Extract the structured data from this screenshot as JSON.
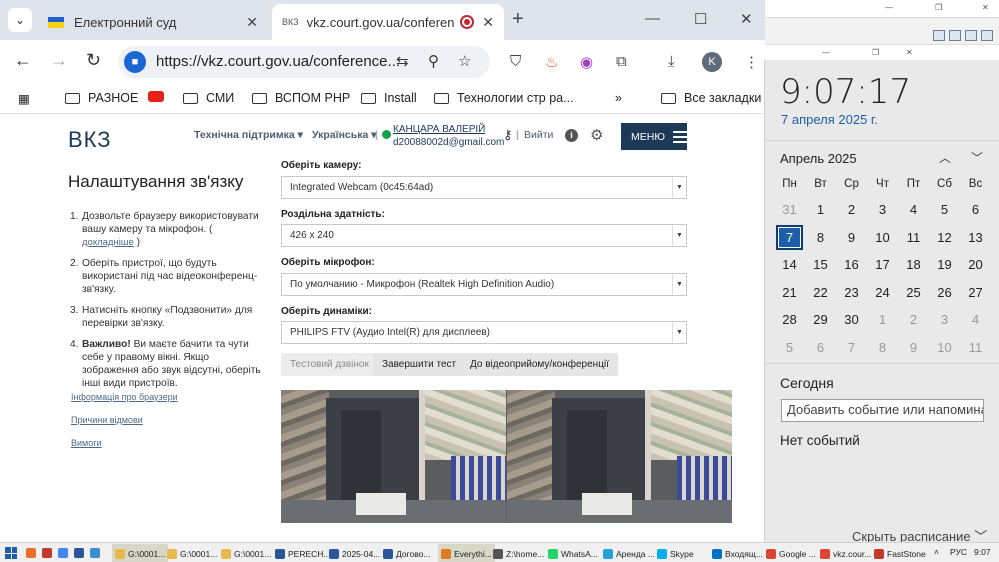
{
  "browser": {
    "tabs": [
      {
        "title": "Електронний суд",
        "favicon": "ukraine-flag-icon",
        "active": false
      },
      {
        "title": "vkz.court.gov.ua/conferenc",
        "favicon_text": "ВКЗ",
        "active": true
      }
    ],
    "url": "https://vkz.court.gov.ua/conference...",
    "profile_initial": "K",
    "bookmarks": [
      "РАЗНОЕ",
      "СМИ",
      "ВСПОМ PHP",
      "Install",
      "Технологии стр ра...",
      "Все закладки"
    ]
  },
  "site": {
    "logo": "ВКЗ",
    "nav": {
      "support": "Технічна підтримка",
      "language": "Українська",
      "user_name": "КАНЦАРА ВАЛЕРІЙ",
      "user_email": "d20088002d@gmail.com",
      "logout": "Вийти",
      "menu": "МЕНЮ"
    },
    "title": "Налаштування зв'язку",
    "steps": [
      {
        "num": "1.",
        "text": "Дозвольте браузеру використовувати вашу камеру та мікрофон. (",
        "link": "докладніше",
        "after": ")"
      },
      {
        "num": "2.",
        "text": "Оберіть пристрої, що будуть використані під час відеоконференц-зв'язку."
      },
      {
        "num": "3.",
        "text": "Натисніть кнопку «Подзвонити» для перевірки зв'язку."
      },
      {
        "num": "4.",
        "bold": "Важливо!",
        "text": " Ви маєте бачити та чути себе у правому вікні. Якщо зображення або звук відсутні, оберіть інші види пристроїв."
      }
    ],
    "side_links": [
      "Інформація про браузери",
      "Причини відмови",
      "Вимоги"
    ],
    "fields": {
      "camera_label": "Оберіть камеру:",
      "camera_value": "Integrated Webcam (0c45:64ad)",
      "resolution_label": "Роздільна здатність:",
      "resolution_value": "426 x 240",
      "mic_label": "Оберіть мікрофон:",
      "mic_value": "По умолчанию - Микрофон (Realtek High Definition Audio)",
      "speaker_label": "Оберіть динаміки:",
      "speaker_value": "PHILIPS FTV (Аудио Intel(R) для дисплеев)"
    },
    "actions": {
      "test_call": "Тестовий дзвінок",
      "finish_test": "Завершити тест",
      "to_conference": "До відеоприйому/конференції"
    }
  },
  "calendar": {
    "time": "9:07:17",
    "date": "7 апреля 2025 г.",
    "month": "Апрель 2025",
    "weekdays": [
      "Пн",
      "Вт",
      "Ср",
      "Чт",
      "Пт",
      "Сб",
      "Вс"
    ],
    "weeks": [
      [
        "31",
        "1",
        "2",
        "3",
        "4",
        "5",
        "6"
      ],
      [
        "7",
        "8",
        "9",
        "10",
        "11",
        "12",
        "13"
      ],
      [
        "14",
        "15",
        "16",
        "17",
        "18",
        "19",
        "20"
      ],
      [
        "21",
        "22",
        "23",
        "24",
        "25",
        "26",
        "27"
      ],
      [
        "28",
        "29",
        "30",
        "1",
        "2",
        "3",
        "4"
      ],
      [
        "5",
        "6",
        "7",
        "8",
        "9",
        "10",
        "11"
      ]
    ],
    "today": "7",
    "today_label": "Сегодня",
    "event_placeholder": "Добавить событие или напоминание",
    "no_events": "Нет событий",
    "hide_schedule": "Скрыть расписание"
  },
  "taskbar": {
    "items": [
      {
        "label": "G:\\0001...",
        "color": "#e8b84a",
        "active": true
      },
      {
        "label": "G:\\0001...",
        "color": "#e8b84a"
      },
      {
        "label": "G:\\0001...",
        "color": "#e8b84a"
      },
      {
        "label": "PERECH...",
        "color": "#2b579a"
      },
      {
        "label": "2025-04...",
        "color": "#2b579a"
      },
      {
        "label": "Догово...",
        "color": "#2b579a"
      },
      {
        "label": "Everythi...",
        "color": "#e07a1f",
        "active": true
      },
      {
        "label": "Z:\\home...",
        "color": "#555555"
      },
      {
        "label": "WhatsA...",
        "color": "#25d366"
      },
      {
        "label": "Аренда ...",
        "color": "#2aa0d8"
      },
      {
        "label": "Skype",
        "color": "#00aff0"
      },
      {
        "label": "Входящ...",
        "color": "#0072c6"
      },
      {
        "label": "Google ...",
        "color": "#db4437"
      },
      {
        "label": "vkz.cour...",
        "color": "#db4437"
      },
      {
        "label": "FastStone",
        "color": "#c0392b"
      }
    ],
    "lang": "РУС",
    "clock": "9:07"
  }
}
